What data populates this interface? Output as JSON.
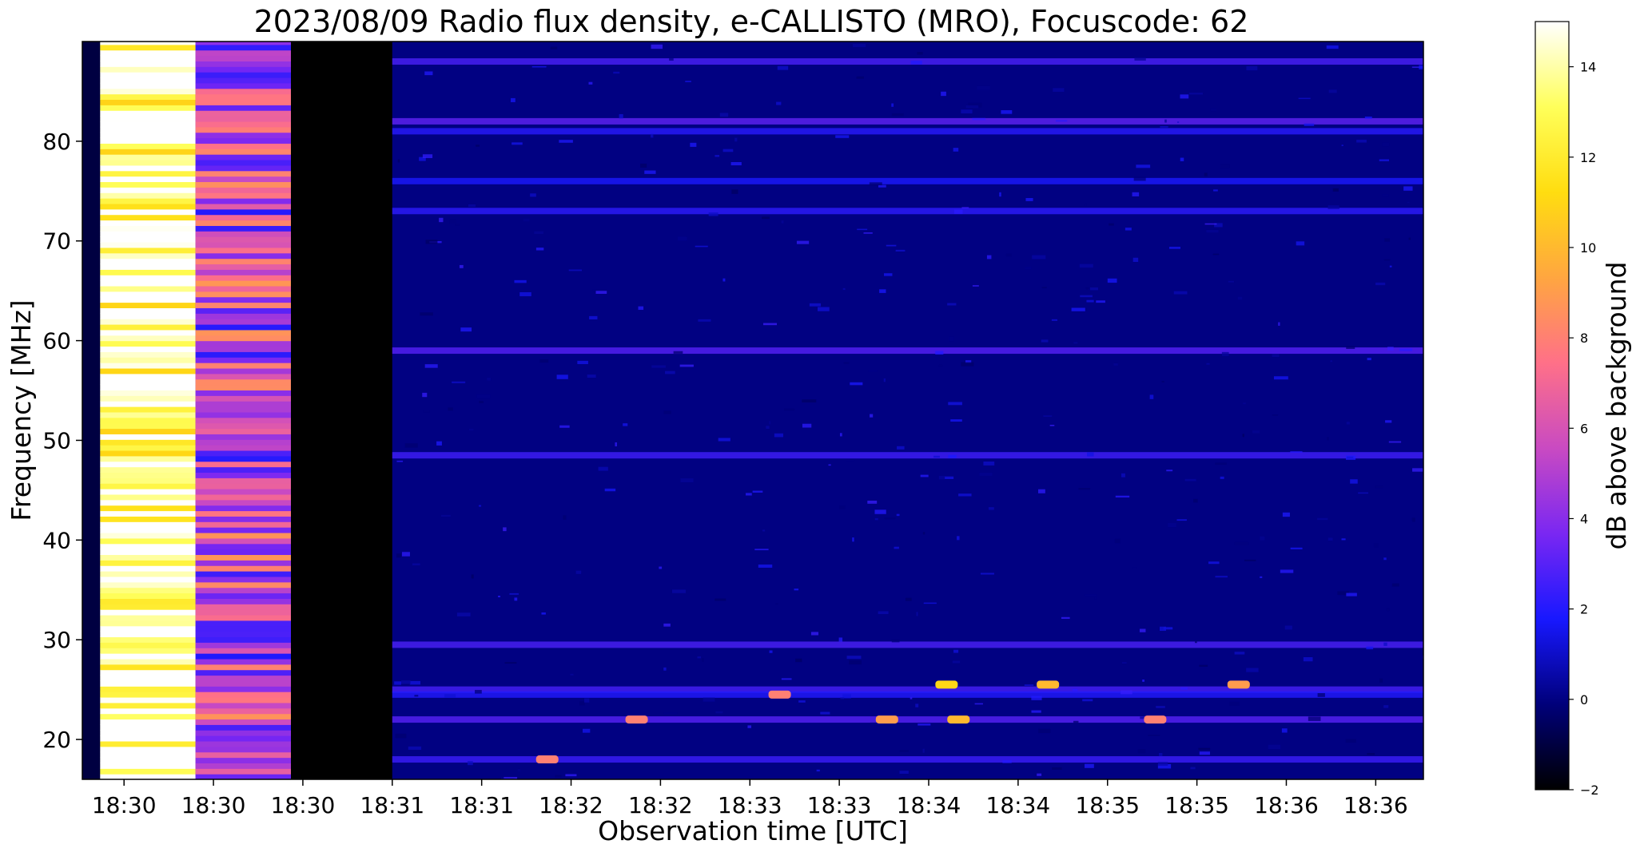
{
  "chart_data": {
    "type": "heatmap",
    "title": "2023/08/09  Radio flux density, e-CALLISTO (MRO), Focuscode: 62",
    "xlabel": "Observation time [UTC]",
    "ylabel": "Frequency [MHz]",
    "x_tick_labels": [
      "18:30",
      "18:30",
      "18:30",
      "18:31",
      "18:31",
      "18:32",
      "18:32",
      "18:33",
      "18:33",
      "18:34",
      "18:34",
      "18:35",
      "18:35",
      "18:36",
      "18:36"
    ],
    "x_tick_seconds": [
      0,
      15,
      30,
      45,
      60,
      75,
      90,
      105,
      120,
      135,
      150,
      165,
      180,
      195,
      210
    ],
    "x_range_seconds": [
      -7,
      218
    ],
    "y_ticks": [
      20,
      30,
      40,
      50,
      60,
      70,
      80
    ],
    "y_range": [
      16,
      90
    ],
    "colorbar": {
      "label": "dB above background",
      "ticks": [
        -2,
        0,
        2,
        4,
        6,
        8,
        10,
        12,
        14
      ],
      "range": [
        -2,
        15
      ],
      "colormap": "gnuplot2",
      "colormap_stops": [
        "#000000",
        "#00007a",
        "#1818ff",
        "#7a27f2",
        "#c94ac2",
        "#ff7088",
        "#ffa640",
        "#ffdd10",
        "#ffff5a",
        "#ffffff"
      ]
    },
    "segments": [
      {
        "t_start": -7,
        "t_end": -4,
        "db_level": -1,
        "description": "dark pre-observation band"
      },
      {
        "t_start": -4,
        "t_end": 12,
        "db_level": 14,
        "description": "saturated bright block (yellow/white)"
      },
      {
        "t_start": 12,
        "t_end": 28,
        "db_level": 5,
        "description": "elevated block (magenta/blue)"
      },
      {
        "t_start": 28,
        "t_end": 45,
        "db_level": -2,
        "description": "near-zero block with faint lines above 59 MHz"
      },
      {
        "t_start": 45,
        "t_end": 218,
        "db_level": 0,
        "description": "background noise with interference bands"
      }
    ],
    "rfi_bands_mhz": [
      88,
      82,
      81,
      76,
      73,
      59,
      48.5,
      29.5,
      25,
      24.5,
      22,
      18
    ],
    "bright_blobs": [
      {
        "t": 110,
        "f": 24.5,
        "db": 8
      },
      {
        "t": 128,
        "f": 22,
        "db": 9
      },
      {
        "t": 140,
        "f": 22,
        "db": 10
      },
      {
        "t": 138,
        "f": 25.5,
        "db": 11
      },
      {
        "t": 155,
        "f": 25.5,
        "db": 10
      },
      {
        "t": 173,
        "f": 22,
        "db": 8
      },
      {
        "t": 187,
        "f": 25.5,
        "db": 9
      },
      {
        "t": 71,
        "f": 18,
        "db": 8
      },
      {
        "t": 86,
        "f": 22,
        "db": 8
      }
    ]
  }
}
